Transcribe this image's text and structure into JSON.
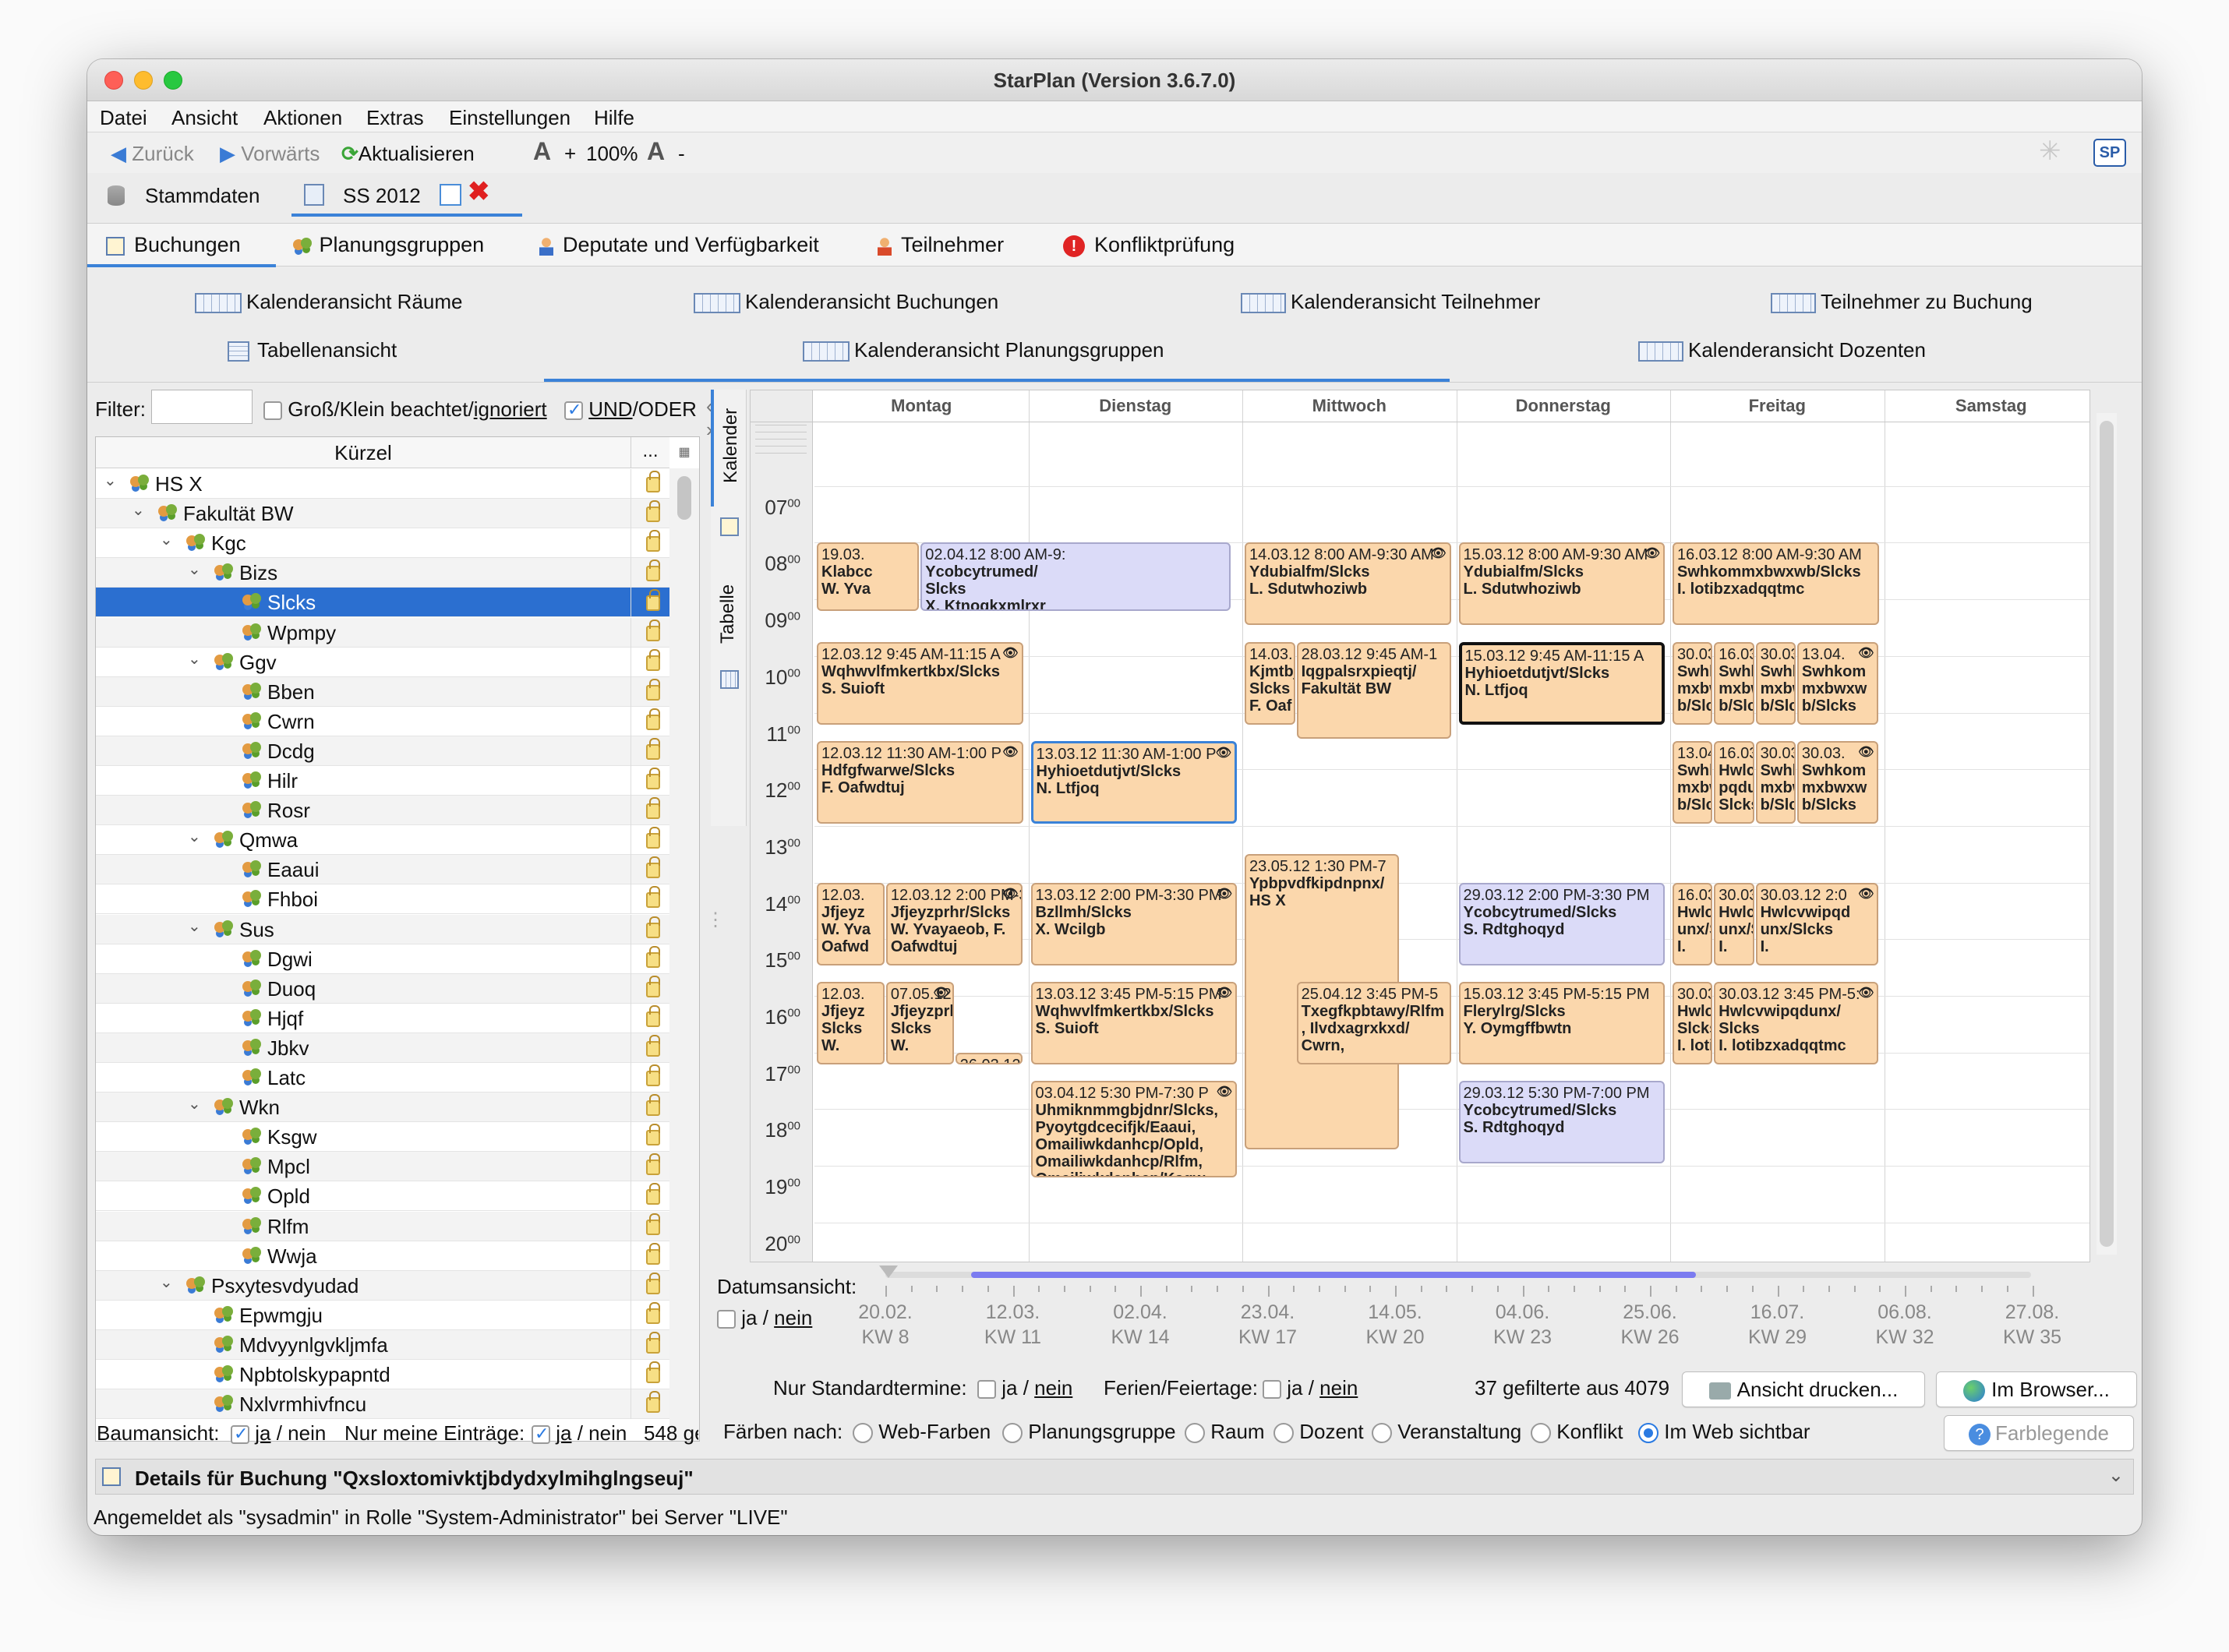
{
  "window": {
    "title": "StarPlan (Version 3.6.7.0)"
  },
  "menu": [
    "Datei",
    "Ansicht",
    "Aktionen",
    "Extras",
    "Einstellungen",
    "Hilfe"
  ],
  "toolbar": {
    "back": "Zurück",
    "forward": "Vorwärts",
    "refresh": "Aktualisieren",
    "zoom_plus": "+",
    "zoom": "100%",
    "zoom_minus": "-"
  },
  "sheets": {
    "master": "Stammdaten",
    "semester": "SS 2012"
  },
  "tabs": [
    "Buchungen",
    "Planungsgruppen",
    "Deputate und Verfügbarkeit",
    "Teilnehmer",
    "Konfliktprüfung"
  ],
  "views": {
    "rooms": "Kalenderansicht Räume",
    "bookings": "Kalenderansicht Buchungen",
    "participants": "Kalenderansicht Teilnehmer",
    "part_booking": "Teilnehmer zu Buchung",
    "table": "Tabellenansicht",
    "groups": "Kalenderansicht Planungsgruppen",
    "lecturers": "Kalenderansicht Dozenten"
  },
  "filter": {
    "label": "Filter:",
    "value": "",
    "case_label": "Groß/Klein beachtet/",
    "case_ignored": "ignoriert",
    "and_label": "UND",
    "or_label": "/ODER"
  },
  "tree": {
    "column": "Kürzel",
    "more": "...",
    "rows": [
      {
        "label": "HS X",
        "level": 0,
        "exp": true
      },
      {
        "label": "Fakultät BW",
        "level": 1,
        "exp": true
      },
      {
        "label": "Kgc",
        "level": 2,
        "exp": true
      },
      {
        "label": "Bizs",
        "level": 3,
        "exp": true
      },
      {
        "label": "Slcks",
        "level": 4,
        "sel": true
      },
      {
        "label": "Wpmpy",
        "level": 4
      },
      {
        "label": "Ggv",
        "level": 3,
        "exp": true
      },
      {
        "label": "Bben",
        "level": 4
      },
      {
        "label": "Cwrn",
        "level": 4
      },
      {
        "label": "Dcdg",
        "level": 4
      },
      {
        "label": "Hilr",
        "level": 4
      },
      {
        "label": "Rosr",
        "level": 4
      },
      {
        "label": "Qmwa",
        "level": 3,
        "exp": true
      },
      {
        "label": "Eaaui",
        "level": 4
      },
      {
        "label": "Fhboi",
        "level": 4
      },
      {
        "label": "Sus",
        "level": 3,
        "exp": true
      },
      {
        "label": "Dgwi",
        "level": 4
      },
      {
        "label": "Duoq",
        "level": 4
      },
      {
        "label": "Hjqf",
        "level": 4
      },
      {
        "label": "Jbkv",
        "level": 4
      },
      {
        "label": "Latc",
        "level": 4
      },
      {
        "label": "Wkn",
        "level": 3,
        "exp": true
      },
      {
        "label": "Ksgw",
        "level": 4
      },
      {
        "label": "Mpcl",
        "level": 4
      },
      {
        "label": "Opld",
        "level": 4
      },
      {
        "label": "Rlfm",
        "level": 4
      },
      {
        "label": "Wwja",
        "level": 4
      },
      {
        "label": "Psxytesvdyudad",
        "level": 2,
        "exp": true
      },
      {
        "label": "Epwmgju",
        "level": 3
      },
      {
        "label": "Mdvyynlgvkljmfa",
        "level": 3
      },
      {
        "label": "Npbtolskypapntd",
        "level": 3
      },
      {
        "label": "Nxlvrmhivfncu",
        "level": 3
      }
    ]
  },
  "side_tabs": {
    "calendar": "Kalender",
    "table": "Tabelle"
  },
  "calendar": {
    "days": [
      "Montag",
      "Dienstag",
      "Mittwoch",
      "Donnerstag",
      "Freitag",
      "Samstag"
    ],
    "hours": [
      "07",
      "08",
      "09",
      "10",
      "11",
      "12",
      "13",
      "14",
      "15",
      "16",
      "17",
      "18",
      "19",
      "20"
    ],
    "minutes": "00",
    "events": [
      {
        "day": 0,
        "start": 8,
        "end": 9.25,
        "col": 0,
        "cols": 2,
        "text": [
          "19.03.",
          "Klabcc",
          "W. Yva"
        ]
      },
      {
        "day": 0,
        "start": 8,
        "end": 9.25,
        "col": 1,
        "cols": 2,
        "span": 3,
        "blue": true,
        "text": [
          "02.04.12 8:00 AM-9:",
          "Ycobcytrumed/",
          "Slcks",
          "X. Ktnogkxmlrxr"
        ]
      },
      {
        "day": 2,
        "start": 8,
        "end": 9.5,
        "eye": true,
        "text": [
          "14.03.12 8:00 AM-9:30 AM",
          "Ydubialfm/Slcks",
          "L. Sdutwhoziwb"
        ]
      },
      {
        "day": 3,
        "start": 8,
        "end": 9.5,
        "eye": true,
        "text": [
          "15.03.12 8:00 AM-9:30 AM",
          "Ydubialfm/Slcks",
          "L. Sdutwhoziwb"
        ]
      },
      {
        "day": 4,
        "start": 8,
        "end": 9.5,
        "text": [
          "16.03.12 8:00 AM-9:30 AM",
          "Swhkommxbwxwb/Slcks",
          "I. lotibzxadqqtmc"
        ]
      },
      {
        "day": 0,
        "start": 9.75,
        "end": 11.25,
        "eye": true,
        "text": [
          "12.03.12 9:45 AM-11:15 A",
          "Wqhwvlfmkertkbx/Slcks",
          "S. Suioft"
        ]
      },
      {
        "day": 2,
        "start": 9.75,
        "end": 11.25,
        "col": 0,
        "cols": 4,
        "text": [
          "14.03.",
          "Kjmtbj",
          "Slcks",
          "F. Oaf"
        ]
      },
      {
        "day": 2,
        "start": 9.75,
        "end": 11.5,
        "col": 1,
        "cols": 4,
        "span": 3,
        "text": [
          "28.03.12 9:45 AM-1",
          "Iqgpalsrxpieqtj/",
          "Fakultät BW"
        ]
      },
      {
        "day": 3,
        "start": 9.75,
        "end": 11.25,
        "sel": true,
        "text": [
          "15.03.12 9:45 AM-11:15 A",
          "Hyhioetdutjvt/Slcks",
          "N. Ltfjoq"
        ]
      },
      {
        "day": 4,
        "start": 9.75,
        "end": 11.25,
        "col": 0,
        "cols": 5,
        "text": [
          "30.03",
          "Swhk",
          "mxbw",
          "b/Slc"
        ]
      },
      {
        "day": 4,
        "start": 9.75,
        "end": 11.25,
        "col": 1,
        "cols": 5,
        "text": [
          "16.03",
          "Swhk",
          "mxbw",
          "b/Slc"
        ]
      },
      {
        "day": 4,
        "start": 9.75,
        "end": 11.25,
        "col": 2,
        "cols": 5,
        "text": [
          "30.03",
          "Swhk",
          "mxbw",
          "b/Slc"
        ]
      },
      {
        "day": 4,
        "start": 9.75,
        "end": 11.25,
        "col": 3,
        "cols": 5,
        "span": 2,
        "eye": true,
        "text": [
          "13.04.",
          "Swhkom",
          "mxbwxw",
          "b/Slcks"
        ]
      },
      {
        "day": 0,
        "start": 11.5,
        "end": 13,
        "eye": true,
        "text": [
          "12.03.12 11:30 AM-1:00 P",
          "Hdfgfwarwe/Slcks",
          "F. Oafwdtuj"
        ]
      },
      {
        "day": 1,
        "start": 11.5,
        "end": 13,
        "selb": true,
        "eye": true,
        "text": [
          "13.03.12 11:30 AM-1:00 P",
          "Hyhioetdutjvt/Slcks",
          "N. Ltfjoq"
        ]
      },
      {
        "day": 4,
        "start": 11.5,
        "end": 13,
        "col": 0,
        "cols": 5,
        "text": [
          "13.04",
          "Swhk",
          "mxbw",
          "b/Slc"
        ]
      },
      {
        "day": 4,
        "start": 11.5,
        "end": 13,
        "col": 1,
        "cols": 5,
        "text": [
          "16.03",
          "Hwlc",
          "pqdu",
          "Slcks"
        ]
      },
      {
        "day": 4,
        "start": 11.5,
        "end": 13,
        "col": 2,
        "cols": 5,
        "text": [
          "30.03",
          "Swhk",
          "mxbw",
          "b/Slc"
        ]
      },
      {
        "day": 4,
        "start": 11.5,
        "end": 13,
        "col": 3,
        "cols": 5,
        "span": 2,
        "eye": true,
        "text": [
          "30.03.",
          "Swhkom",
          "mxbwxw",
          "b/Slcks"
        ]
      },
      {
        "day": 2,
        "start": 13.5,
        "end": 18.75,
        "col": 0,
        "cols": 4,
        "span": 3,
        "text": [
          "23.05.12 1:30 PM-7",
          "Ypbpvdfkipdnpnx/",
          "HS X"
        ]
      },
      {
        "day": 0,
        "start": 14,
        "end": 15.5,
        "col": 0,
        "cols": 3,
        "text": [
          "12.03.",
          "Jfjeyz",
          "W. Yva",
          "Oafwd"
        ]
      },
      {
        "day": 0,
        "start": 14,
        "end": 15.5,
        "col": 1,
        "cols": 3,
        "span": 2,
        "eye": true,
        "text": [
          "12.03.12 2:00 PM-3:",
          "Jfjeyzprhr/Slcks",
          "W. Yvayaeob, F.",
          "Oafwdtuj"
        ]
      },
      {
        "day": 1,
        "start": 14,
        "end": 15.5,
        "eye": true,
        "text": [
          "13.03.12 2:00 PM-3:30 PM",
          "Bzllmh/Slcks",
          "X. Wcilgb"
        ]
      },
      {
        "day": 3,
        "start": 14,
        "end": 15.5,
        "blue": true,
        "text": [
          "29.03.12 2:00 PM-3:30 PM",
          "Ycobcytrumed/Slcks",
          "S. Rdtghoqyd"
        ]
      },
      {
        "day": 4,
        "start": 14,
        "end": 15.5,
        "col": 0,
        "cols": 5,
        "text": [
          "16.03.",
          "Hwlcv",
          "unx/Sl",
          "I."
        ]
      },
      {
        "day": 4,
        "start": 14,
        "end": 15.5,
        "col": 1,
        "cols": 5,
        "text": [
          "30.03.",
          "Hwlcv",
          "unx/Sl",
          "I."
        ]
      },
      {
        "day": 4,
        "start": 14,
        "end": 15.5,
        "col": 2,
        "cols": 5,
        "span": 3,
        "eye": true,
        "text": [
          "30.03.12 2:0",
          "Hwlcvwipqd",
          "unx/Slcks",
          "I."
        ]
      },
      {
        "day": 0,
        "start": 15.75,
        "end": 17.25,
        "col": 0,
        "cols": 3,
        "text": [
          "12.03.",
          "Jfjeyz",
          "Slcks",
          "W."
        ]
      },
      {
        "day": 0,
        "start": 15.75,
        "end": 17.25,
        "col": 1,
        "cols": 3,
        "eye": true,
        "text": [
          "07.05.12 3:",
          "Jfjeyzprhr/",
          "Slcks",
          "W."
        ]
      },
      {
        "day": 0,
        "start": 17,
        "end": 17.25,
        "col": 2,
        "cols": 3,
        "text": [
          "26.03.12 5:0"
        ]
      },
      {
        "day": 1,
        "start": 15.75,
        "end": 17.25,
        "eye": true,
        "text": [
          "13.03.12 3:45 PM-5:15 PM",
          "Wqhwvlfmkertkbx/Slcks",
          "S. Suioft"
        ]
      },
      {
        "day": 2,
        "start": 15.75,
        "end": 17.25,
        "col": 1,
        "cols": 4,
        "span": 3,
        "text": [
          "25.04.12 3:45 PM-5",
          "Txegfkpbtawy/Rlfm",
          ", Ilvdxagrxkxd/",
          "Cwrn,"
        ]
      },
      {
        "day": 3,
        "start": 15.75,
        "end": 17.25,
        "text": [
          "15.03.12 3:45 PM-5:15 PM",
          "Flerylrg/Slcks",
          "Y. Oymgffbwtn"
        ]
      },
      {
        "day": 4,
        "start": 15.75,
        "end": 17.25,
        "col": 0,
        "cols": 5,
        "text": [
          "30.03.",
          "Hwlcv",
          "Slcks",
          "I. lotib"
        ]
      },
      {
        "day": 4,
        "start": 15.75,
        "end": 17.25,
        "col": 1,
        "cols": 5,
        "span": 4,
        "eye": true,
        "text": [
          "30.03.12 3:45 PM-5:",
          "Hwlcvwipqdunx/",
          "Slcks",
          "I. lotibzxadqqtmc"
        ]
      },
      {
        "day": 1,
        "start": 17.5,
        "end": 19.25,
        "eye": true,
        "text": [
          "03.04.12 5:30 PM-7:30 P",
          "Uhmiknmmgbjdnr/Slcks,",
          "Pyoytgdcecifjk/Eaaui,",
          "Omailiwkdanhcp/Opld,",
          "Omailiwkdanhcp/Rlfm,",
          "Omailiwkdanhcp/Ksgw,"
        ]
      },
      {
        "day": 3,
        "start": 17.5,
        "end": 19,
        "blue": true,
        "text": [
          "29.03.12 5:30 PM-7:00 PM",
          "Ycobcytrumed/Slcks",
          "S. Rdtghoqyd"
        ]
      }
    ]
  },
  "timeline": {
    "label": "Datumsansicht:",
    "ja": "ja",
    "nein": "nein",
    "ticks": [
      [
        "20.02.",
        "KW 8"
      ],
      [
        "12.03.",
        "KW 11"
      ],
      [
        "02.04.",
        "KW 14"
      ],
      [
        "23.04.",
        "KW 17"
      ],
      [
        "14.05.",
        "KW 20"
      ],
      [
        "04.06.",
        "KW 23"
      ],
      [
        "25.06.",
        "KW 26"
      ],
      [
        "16.07.",
        "KW 29"
      ],
      [
        "06.08.",
        "KW 32"
      ],
      [
        "27.08.",
        "KW 35"
      ]
    ]
  },
  "footer": {
    "std_label": "Nur Standardtermine:",
    "holiday_label": "Ferien/Feiertage:",
    "count": "37 gefilterte aus 4079",
    "print": "Ansicht drucken...",
    "browser": "Im Browser...",
    "color_label": "Färben nach:",
    "color_options": [
      "Web-Farben",
      "Planungsgruppe",
      "Raum",
      "Dozent",
      "Veranstaltung",
      "Konflikt",
      "Im Web sichtbar"
    ],
    "legend": "Farblegende",
    "tree_view": "Baumansicht:",
    "my_entries": "Nur meine Einträge:",
    "gen": "548 ge"
  },
  "details": {
    "title": "Details für Buchung \"Qxsloxtomivktjbdydxylmihglngseuj\""
  },
  "status": "Angemeldet als \"sysadmin\" in Rolle \"System-Administrator\" bei Server \"LIVE\"",
  "colors": {
    "event": "#fbd7ac",
    "event_blue": "#dbdbf8",
    "selection": "#2b6fd0",
    "accent": "#3b82d8"
  }
}
